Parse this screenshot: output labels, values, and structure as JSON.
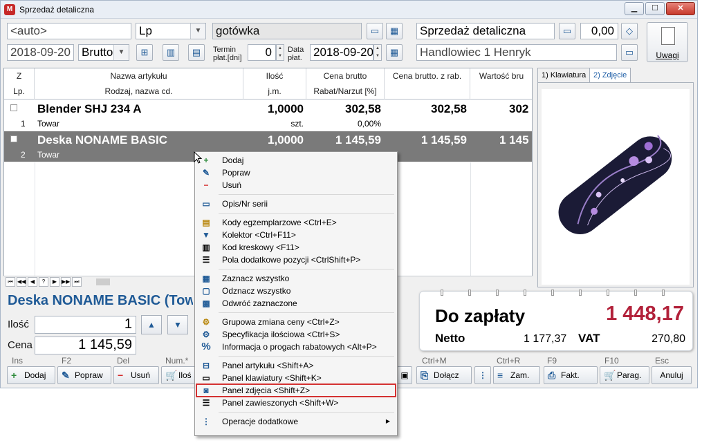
{
  "window": {
    "title": "Sprzedaż detaliczna",
    "app_icon": "M",
    "min": "▁",
    "max": "☐",
    "close": "✕"
  },
  "header": {
    "number_field": "<auto>",
    "series_field": "Lp",
    "date_field": "2018-09-20",
    "price_type": "Brutto",
    "payment_field": "gotówka",
    "term_label_1": "Termin",
    "term_label_2": "płat.[dni]",
    "term_value": "0",
    "data_label_1": "Data",
    "data_label_2": "płat.",
    "payment_date": "2018-09-20",
    "doc_type": "Sprzedaż detaliczna",
    "amount": "0,00",
    "seller": "Handlowiec 1 Henryk",
    "notes_button": "Uwagi"
  },
  "grid": {
    "headers": [
      {
        "top": "Z",
        "bottom": "Lp."
      },
      {
        "top": "Nazwa artykułu",
        "bottom": "Rodzaj, nazwa cd."
      },
      {
        "top": "Ilość",
        "bottom": "j.m."
      },
      {
        "top": "Cena brutto",
        "bottom": "Rabat/Narzut [%]"
      },
      {
        "top": "Cena brutto. z rab.",
        "bottom": ""
      },
      {
        "top": "Wartość bru",
        "bottom": ""
      }
    ],
    "rows": [
      {
        "lp": "1",
        "name": "Blender SHJ 234 A",
        "type": "Towar",
        "qty": "1,0000",
        "unit": "szt.",
        "price": "302,58",
        "discount": "0,00%",
        "price_disc": "302,58",
        "value": "302"
      },
      {
        "lp": "2",
        "name": "Deska NONAME BASIC",
        "type": "Towar",
        "qty": "1,0000",
        "unit": "",
        "price": "1 145,59",
        "discount": "",
        "price_disc": "1 145,59",
        "value": "1 145"
      }
    ],
    "nav": [
      "⏮",
      "◀◀",
      "◀",
      "?",
      "▶",
      "▶▶",
      "⏭"
    ]
  },
  "side_tabs": [
    {
      "label": "1) Klawiatura"
    },
    {
      "label": "2) Zdjęcie"
    }
  ],
  "item_panel": {
    "name": "Deska NONAME BASIC (Tow",
    "qty_label": "Ilość",
    "qty_value": "1",
    "price_label": "Cena",
    "price_value": "1 145,59"
  },
  "payment": {
    "label": "Do zapłaty",
    "total": "1 448,17",
    "netto_label": "Netto",
    "netto_value": "1 177,37",
    "vat_label": "VAT",
    "vat_value": "270,80",
    "total_color": "#b2213a"
  },
  "bottom_keys": {
    "ins": "Ins",
    "f2": "F2",
    "del": "Del",
    "num": "Num.*",
    "ctrlm": "Ctrl+M",
    "ctrlr": "Ctrl+R",
    "f9": "F9",
    "f10": "F10",
    "esc": "Esc"
  },
  "bottom_buttons": {
    "add": "Dodaj",
    "edit": "Popraw",
    "del": "Usuń",
    "qty": "Iloś",
    "attach": "Dołącz",
    "order": "Zam.",
    "invoice": "Fakt.",
    "receipt": "Parag.",
    "cancel": "Anuluj"
  },
  "context_menu": [
    {
      "label": "Dodaj",
      "icon": "plus-icon"
    },
    {
      "label": "Popraw",
      "icon": "pencil-icon"
    },
    {
      "label": "Usuń",
      "icon": "minus-icon"
    },
    {
      "label": "Opis/Nr serii",
      "icon": "comment-icon"
    },
    {
      "label": "Kody egzemplarzowe <Ctrl+E>",
      "icon": "code-icon"
    },
    {
      "label": "Kolektor <Ctrl+F11>",
      "icon": "collector-icon"
    },
    {
      "label": "Kod kreskowy <F11>",
      "icon": "barcode-icon"
    },
    {
      "label": "Pola dodatkowe pozycji <CtrlShift+P>",
      "icon": "fields-icon"
    },
    {
      "label": "Zaznacz wszystko",
      "icon": "select-all-icon"
    },
    {
      "label": "Odznacz wszystko",
      "icon": "deselect-all-icon"
    },
    {
      "label": "Odwróć zaznaczone",
      "icon": "invert-selection-icon"
    },
    {
      "label": "Grupowa zmiana ceny <Ctrl+Z>",
      "icon": "group-price-icon"
    },
    {
      "label": "Specyfikacja ilościowa <Ctrl+S>",
      "icon": "spec-icon"
    },
    {
      "label": "Informacja o progach rabatowych <Alt+P>",
      "icon": "percent-icon"
    },
    {
      "label": "Panel artykułu <Shift+A>",
      "icon": "panel-icon"
    },
    {
      "label": "Panel klawiatury <Shift+K>",
      "icon": "keyboard-icon"
    },
    {
      "label": "Panel zdjęcia <Shift+Z>",
      "icon": "camera-icon"
    },
    {
      "label": "Panel zawieszonych <Shift+W>",
      "icon": "suspended-icon"
    },
    {
      "label": "Operacje dodatkowe",
      "icon": "ops-icon",
      "submenu": "▶"
    }
  ]
}
